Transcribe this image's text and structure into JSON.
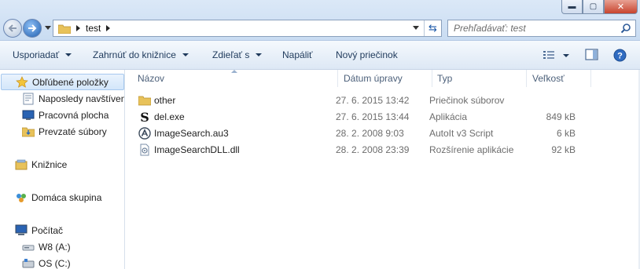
{
  "window": {
    "controls": {
      "minimize": "▬",
      "maximize": "▢",
      "close": "✕"
    }
  },
  "address": {
    "path": [
      "test"
    ],
    "refresh_glyph": "⇆"
  },
  "search": {
    "placeholder": "Prehľadávať: test"
  },
  "toolbar": {
    "organize": "Usporiadať",
    "include_library": "Zahrnúť do knižnice",
    "share": "Zdieľať s",
    "burn": "Napáliť",
    "new_folder": "Nový priečinok"
  },
  "sidebar": {
    "favorites": {
      "label": "Obľúbené položky",
      "items": [
        {
          "label": "Naposledy navštívené",
          "icon": "recent-places-icon"
        },
        {
          "label": "Pracovná plocha",
          "icon": "desktop-icon"
        },
        {
          "label": "Prevzaté súbory",
          "icon": "downloads-icon"
        }
      ]
    },
    "libraries": {
      "label": "Knižnice"
    },
    "homegroup": {
      "label": "Domáca skupina"
    },
    "computer": {
      "label": "Počítač",
      "items": [
        {
          "label": "W8 (A:)",
          "icon": "floppy-drive-icon"
        },
        {
          "label": "OS (C:)",
          "icon": "hard-drive-icon"
        }
      ]
    }
  },
  "columns": {
    "name": "Názov",
    "date": "Dátum úpravy",
    "type": "Typ",
    "size": "Veľkosť"
  },
  "files": [
    {
      "name": "other",
      "date": "27. 6. 2015 13:42",
      "type": "Priečinok súborov",
      "size": "",
      "icon": "folder-icon"
    },
    {
      "name": "del.exe",
      "date": "27. 6. 2015 13:44",
      "type": "Aplikácia",
      "size": "849 kB",
      "icon": "exe-icon"
    },
    {
      "name": "ImageSearch.au3",
      "date": "28. 2. 2008 9:03",
      "type": "AutoIt v3 Script",
      "size": "6 kB",
      "icon": "autoit-script-icon"
    },
    {
      "name": "ImageSearchDLL.dll",
      "date": "28. 2. 2008 23:39",
      "type": "Rozšírenie aplikácie",
      "size": "92 kB",
      "icon": "dll-icon"
    }
  ],
  "colors": {
    "accent": "#1e395b",
    "selection": "#d3e6fa",
    "folder": "#e8c25a"
  }
}
